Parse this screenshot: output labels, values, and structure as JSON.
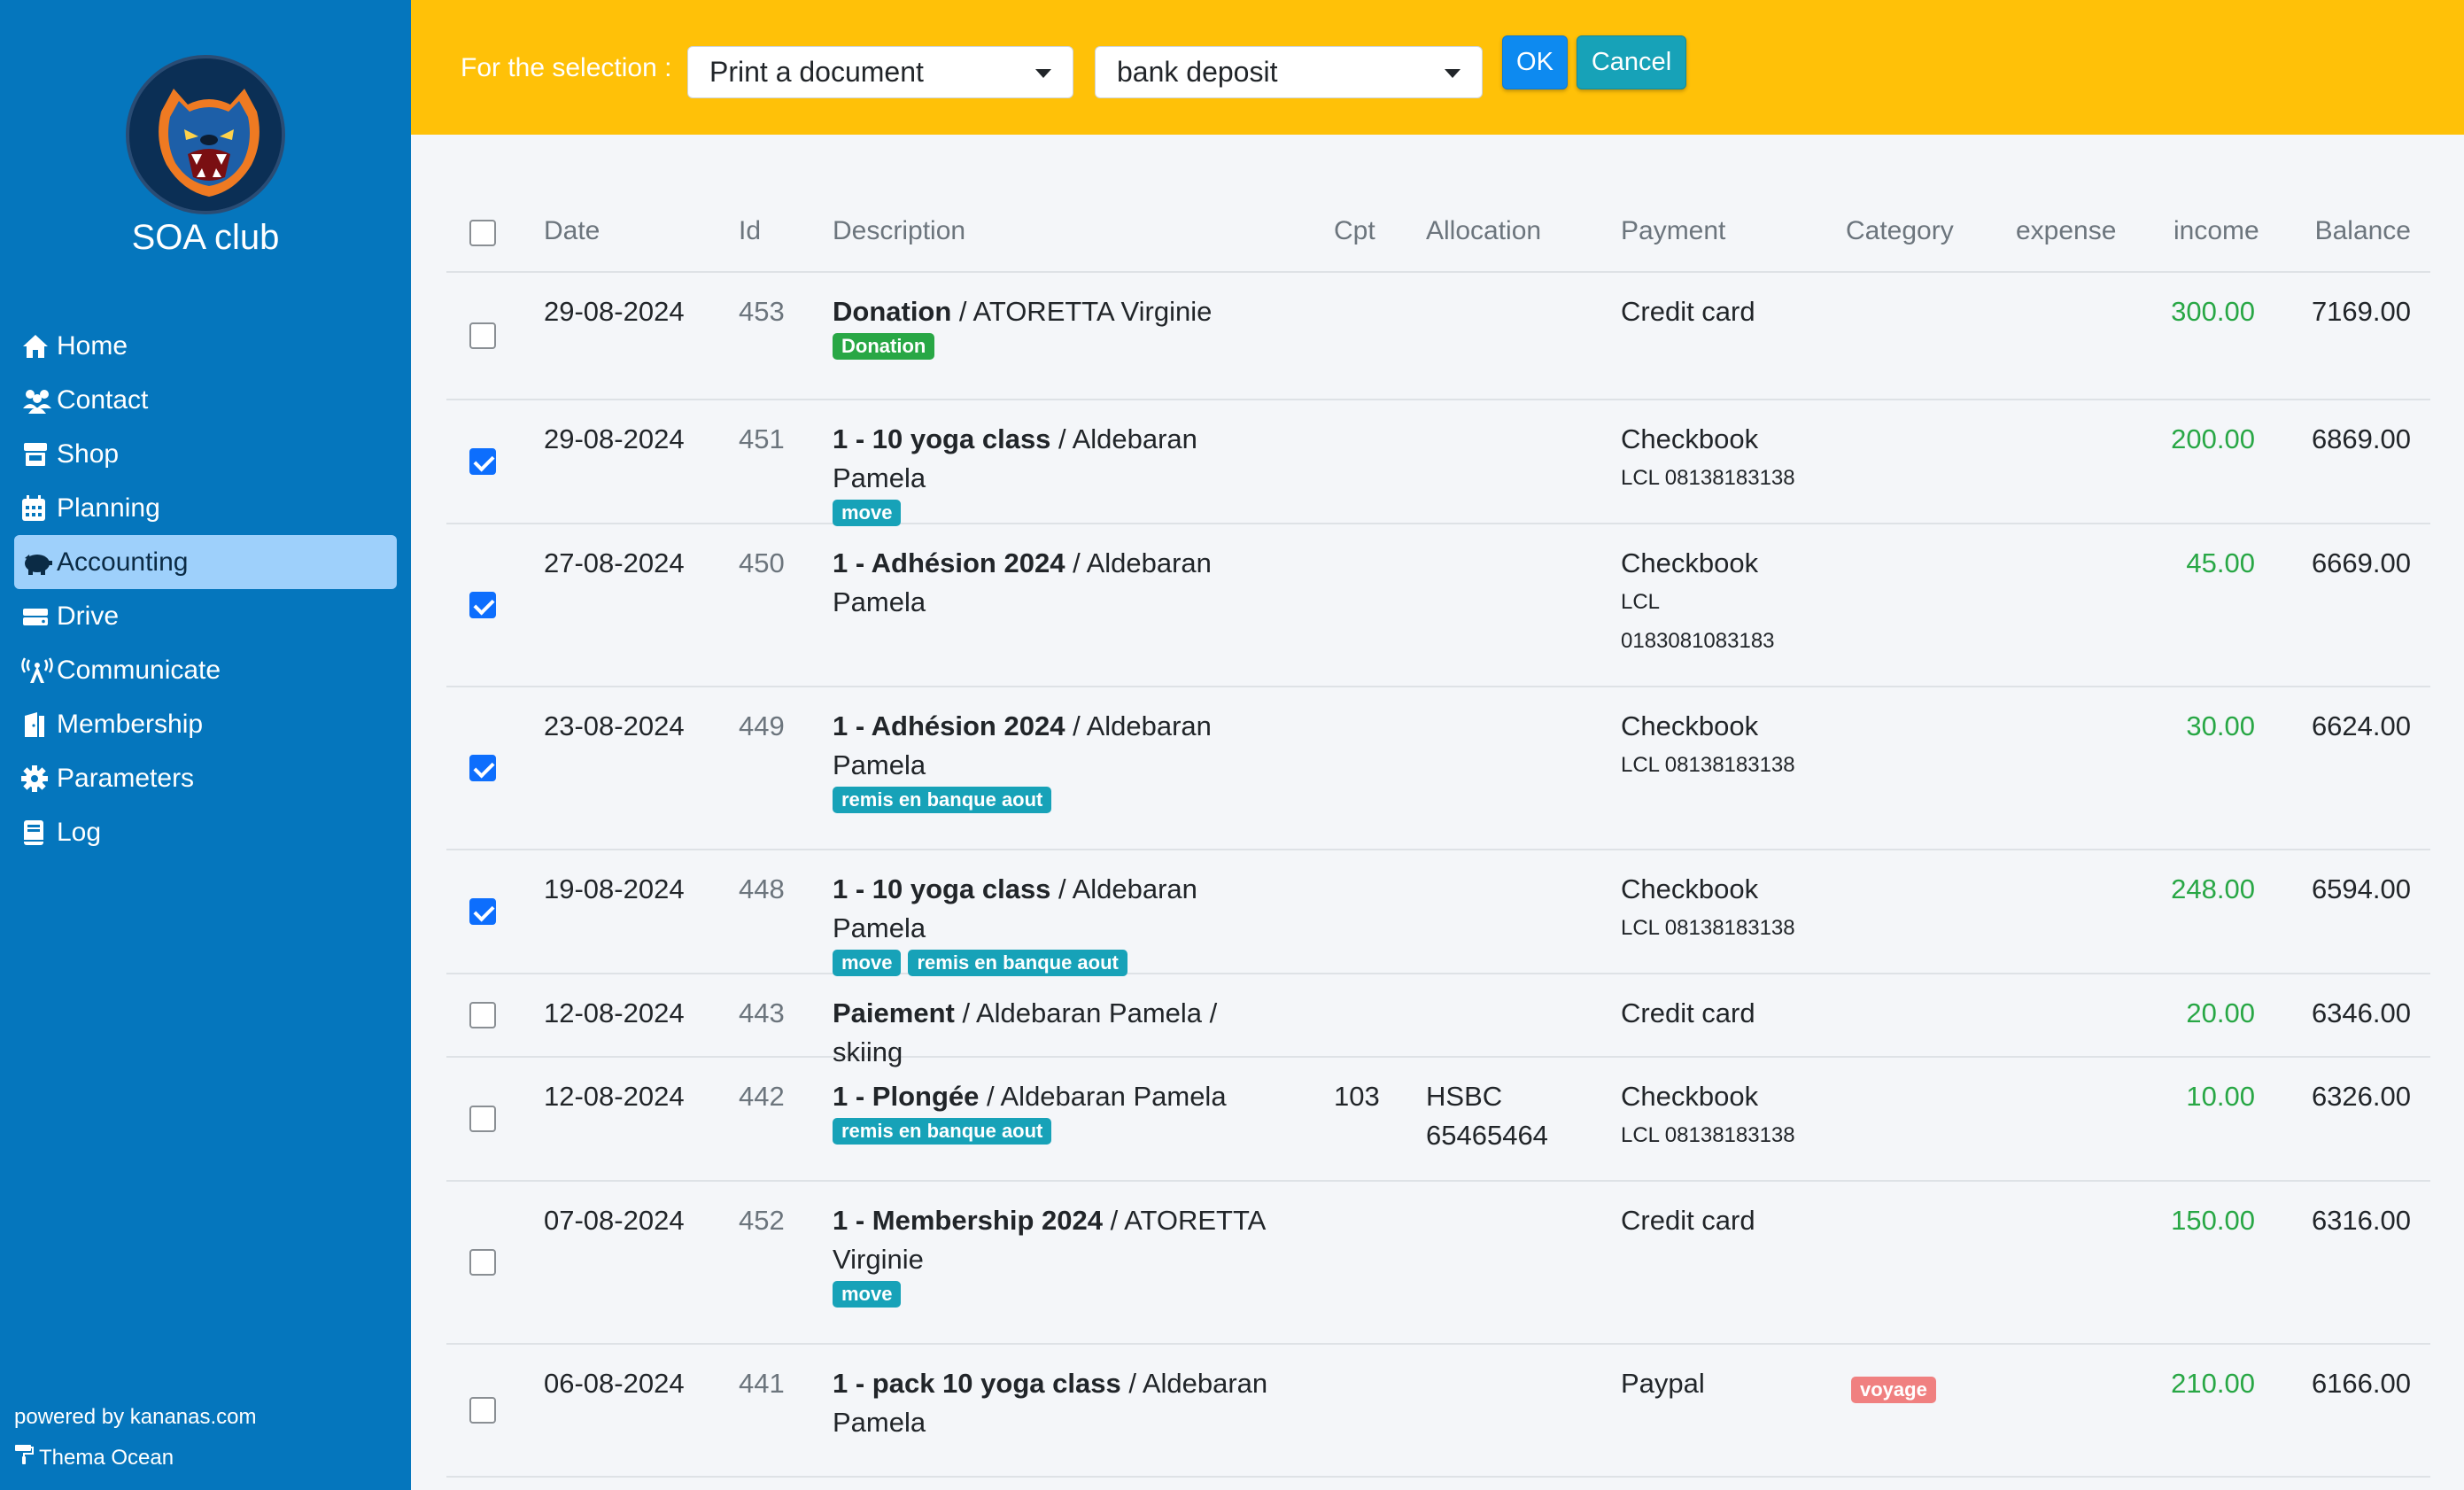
{
  "sidebar": {
    "brand": "SOA club",
    "items": [
      {
        "label": "Home",
        "icon": "home-icon"
      },
      {
        "label": "Contact",
        "icon": "users-icon"
      },
      {
        "label": "Shop",
        "icon": "store-icon"
      },
      {
        "label": "Planning",
        "icon": "calendar-icon"
      },
      {
        "label": "Accounting",
        "icon": "piggy-bank-icon"
      },
      {
        "label": "Drive",
        "icon": "hdd-icon"
      },
      {
        "label": "Communicate",
        "icon": "broadcast-icon"
      },
      {
        "label": "Membership",
        "icon": "door-icon"
      },
      {
        "label": "Parameters",
        "icon": "gear-icon"
      },
      {
        "label": "Log",
        "icon": "book-icon"
      }
    ],
    "active": "Accounting",
    "powered": "powered by kananas.com",
    "theme": "Thema Ocean"
  },
  "toolbar": {
    "label": "For the selection :",
    "action_select": "Print a document",
    "type_select": "bank deposit",
    "ok_label": "OK",
    "cancel_label": "Cancel"
  },
  "table": {
    "headers": {
      "date": "Date",
      "id": "Id",
      "description": "Description",
      "cpt": "Cpt",
      "allocation": "Allocation",
      "payment": "Payment",
      "category": "Category",
      "expense": "expense",
      "income": "income",
      "balance": "Balance"
    },
    "rows": [
      {
        "checked": false,
        "date": "29-08-2024",
        "id": "453",
        "title": "Donation",
        "desc_l1": " / ATORETTA Virginie",
        "desc_l2": "",
        "badges": [
          "Donation"
        ],
        "cpt": "",
        "alloc1": "",
        "alloc2": "",
        "payment": "Credit card",
        "pay_sub1": "",
        "pay_sub2": "",
        "category": "",
        "income": "300.00",
        "balance": "7169.00"
      },
      {
        "checked": true,
        "date": "29-08-2024",
        "id": "451",
        "title": "1 - 10 yoga class",
        "desc_l1": " / Aldebaran Pamela",
        "desc_l2": "",
        "badges": [
          "move"
        ],
        "cpt": "",
        "alloc1": "",
        "alloc2": "",
        "payment": "Checkbook",
        "pay_sub1": "LCL 08138183138",
        "pay_sub2": "",
        "category": "",
        "income": "200.00",
        "balance": "6869.00"
      },
      {
        "checked": true,
        "date": "27-08-2024",
        "id": "450",
        "title": "1 - Adhésion 2024",
        "desc_l1": " / Aldebaran",
        "desc_l2": "Pamela",
        "badges": [],
        "cpt": "",
        "alloc1": "",
        "alloc2": "",
        "payment": "Checkbook",
        "pay_sub1": "LCL",
        "pay_sub2": "0183081083183",
        "category": "",
        "income": "45.00",
        "balance": "6669.00"
      },
      {
        "checked": true,
        "date": "23-08-2024",
        "id": "449",
        "title": "1 - Adhésion 2024",
        "desc_l1": " / Aldebaran",
        "desc_l2": "Pamela",
        "badges": [
          "remis en banque aout"
        ],
        "cpt": "",
        "alloc1": "",
        "alloc2": "",
        "payment": "Checkbook",
        "pay_sub1": "LCL 08138183138",
        "pay_sub2": "",
        "category": "",
        "income": "30.00",
        "balance": "6624.00"
      },
      {
        "checked": true,
        "date": "19-08-2024",
        "id": "448",
        "title": "1 - 10 yoga class",
        "desc_l1": " / Aldebaran Pamela",
        "desc_l2": "",
        "badges": [
          "move",
          "remis en banque aout"
        ],
        "cpt": "",
        "alloc1": "",
        "alloc2": "",
        "payment": "Checkbook",
        "pay_sub1": "LCL 08138183138",
        "pay_sub2": "",
        "category": "",
        "income": "248.00",
        "balance": "6594.00"
      },
      {
        "checked": false,
        "date": "12-08-2024",
        "id": "443",
        "title": "Paiement",
        "desc_l1": " / Aldebaran Pamela / skiing",
        "desc_l2": "",
        "badges": [],
        "cpt": "",
        "alloc1": "",
        "alloc2": "",
        "payment": "Credit card",
        "pay_sub1": "",
        "pay_sub2": "",
        "category": "",
        "income": "20.00",
        "balance": "6346.00"
      },
      {
        "checked": false,
        "date": "12-08-2024",
        "id": "442",
        "title": "1 - Plongée",
        "desc_l1": " / Aldebaran Pamela",
        "desc_l2": "",
        "badges": [
          "remis en banque aout"
        ],
        "cpt": "103",
        "alloc1": "HSBC",
        "alloc2": "65465464",
        "payment": "Checkbook",
        "pay_sub1": "LCL 08138183138",
        "pay_sub2": "",
        "category": "",
        "income": "10.00",
        "balance": "6326.00"
      },
      {
        "checked": false,
        "date": "07-08-2024",
        "id": "452",
        "title": "1 - Membership 2024",
        "desc_l1": " / ATORETTA",
        "desc_l2": "Virginie",
        "badges": [
          "move"
        ],
        "cpt": "",
        "alloc1": "",
        "alloc2": "",
        "payment": "Credit card",
        "pay_sub1": "",
        "pay_sub2": "",
        "category": "",
        "income": "150.00",
        "balance": "6316.00"
      },
      {
        "checked": false,
        "date": "06-08-2024",
        "id": "441",
        "title": "1 - pack 10 yoga class",
        "desc_l1": " / Aldebaran",
        "desc_l2": "Pamela",
        "badges": [],
        "cpt": "",
        "alloc1": "",
        "alloc2": "",
        "payment": "Paypal",
        "pay_sub1": "",
        "pay_sub2": "",
        "category": "voyage",
        "income": "210.00",
        "balance": "6166.00"
      }
    ]
  },
  "colors": {
    "sidebar": "#0576bd",
    "topbar": "#ffc108",
    "income": "#28a745",
    "badge_donation": "#28a745",
    "badge_teal": "#17a2b8",
    "badge_category": "#f08080"
  }
}
